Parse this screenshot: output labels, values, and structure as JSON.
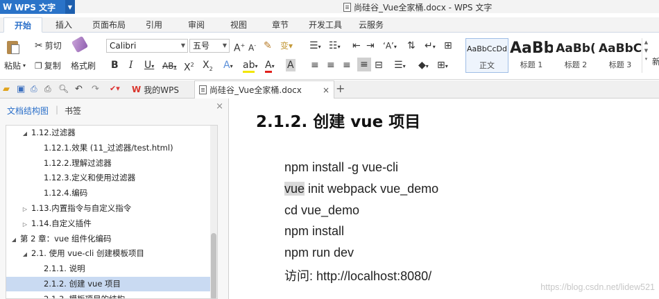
{
  "app": {
    "name": "WPS 文字",
    "document_title": "尚硅谷_Vue全家桶.docx - WPS 文字"
  },
  "ribbon_tabs": [
    "开始",
    "插入",
    "页面布局",
    "引用",
    "审阅",
    "视图",
    "章节",
    "开发工具",
    "云服务"
  ],
  "ribbon": {
    "paste": "粘贴",
    "cut": "剪切",
    "copy": "复制",
    "format_painter": "格式刷",
    "font_name": "Calibri",
    "font_size": "五号",
    "styles": [
      {
        "preview": "AaBbCcDd",
        "name": "正文"
      },
      {
        "preview": "AaBb",
        "name": "标题 1"
      },
      {
        "preview": "AaBb(",
        "name": "标题 2"
      },
      {
        "preview": "AaBbC",
        "name": "标题 3"
      }
    ],
    "more_styles": "新"
  },
  "quickbar": {
    "tabs": [
      {
        "label": "我的WPS",
        "active": false
      },
      {
        "label": "尚硅谷_Vue全家桶.docx",
        "active": true
      }
    ],
    "close": "×",
    "add": "+"
  },
  "left_panel": {
    "tabs": [
      "文档结构图",
      "书签"
    ],
    "close": "×",
    "tree": [
      {
        "label": "1.12.过滤器",
        "twisty": "◢",
        "indent": 1
      },
      {
        "label": "1.12.1.效果 (11_过滤器/test.html)",
        "twisty": "",
        "indent": 2
      },
      {
        "label": "1.12.2.理解过滤器",
        "twisty": "",
        "indent": 2
      },
      {
        "label": "1.12.3.定义和使用过滤器",
        "twisty": "",
        "indent": 2
      },
      {
        "label": "1.12.4.编码",
        "twisty": "",
        "indent": 2
      },
      {
        "label": "1.13.内置指令与自定义指令",
        "twisty": "▷",
        "indent": 1
      },
      {
        "label": "1.14.自定义插件",
        "twisty": "▷",
        "indent": 1
      },
      {
        "label": "第 2 章：vue 组件化编码",
        "twisty": "◢",
        "indent": 0
      },
      {
        "label": "2.1. 使用 vue-cli 创建模板项目",
        "twisty": "◢",
        "indent": 1
      },
      {
        "label": "2.1.1. 说明",
        "twisty": "",
        "indent": 2
      },
      {
        "label": "2.1.2. 创建 vue 项目",
        "twisty": "",
        "indent": 2,
        "selected": true
      },
      {
        "label": "2.1.3. 模板项目的结构",
        "twisty": "",
        "indent": 2
      }
    ]
  },
  "document": {
    "heading": "2.1.2.  创建 vue 项目",
    "lines": [
      "npm install -g vue-cli",
      "vue init webpack vue_demo",
      "cd vue_demo",
      "npm install",
      "npm run dev",
      "访问: http://localhost:8080/"
    ],
    "highlight_word": "vue",
    "watermark": "https://blog.csdn.net/lidew521"
  },
  "colors": {
    "accent": "#2a73c8",
    "selection": "#c9daf2",
    "tab_active_text": "#2a6fc9"
  }
}
